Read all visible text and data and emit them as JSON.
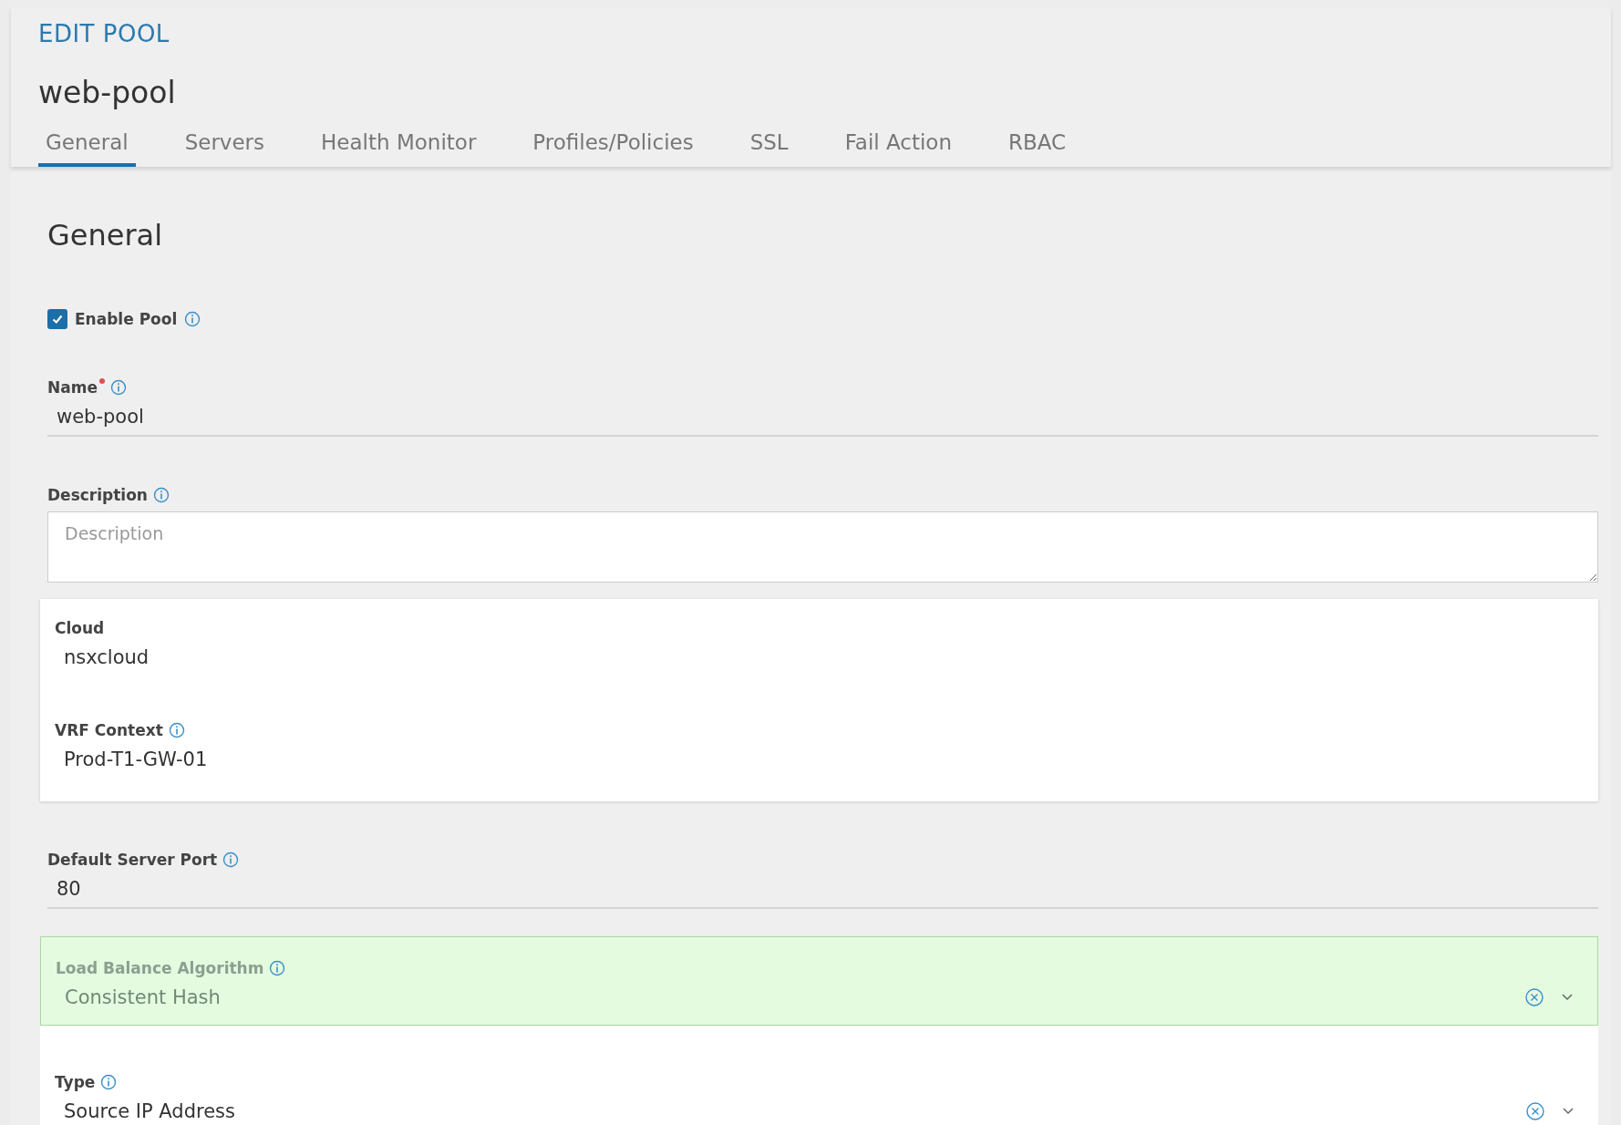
{
  "header": {
    "title": "EDIT POOL",
    "name": "web-pool"
  },
  "tabs": [
    {
      "label": "General",
      "selected": true
    },
    {
      "label": "Servers",
      "selected": false
    },
    {
      "label": "Health Monitor",
      "selected": false
    },
    {
      "label": "Profiles/Policies",
      "selected": false
    },
    {
      "label": "SSL",
      "selected": false
    },
    {
      "label": "Fail Action",
      "selected": false
    },
    {
      "label": "RBAC",
      "selected": false
    }
  ],
  "section_title": "General",
  "enable_pool": {
    "label": "Enable Pool",
    "checked": true,
    "info": true
  },
  "items": [
    {
      "kind": "text",
      "label": "Name",
      "required": true,
      "info": true,
      "value": "web-pool"
    },
    {
      "kind": "textarea",
      "label": "Description",
      "required": false,
      "info": true,
      "placeholder": "Description"
    },
    {
      "kind": "card",
      "fields": [
        {
          "label": "Cloud",
          "info": false,
          "value": "nsxcloud"
        },
        {
          "label": "VRF Context",
          "info": true,
          "value": "Prod-T1-GW-01"
        }
      ]
    },
    {
      "kind": "text",
      "label": "Default Server Port",
      "required": false,
      "info": true,
      "value": "80"
    },
    {
      "kind": "select",
      "label": "Load Balance Algorithm",
      "info": true,
      "highlighted": true,
      "value": "Consistent Hash"
    },
    {
      "kind": "select",
      "label": "Type",
      "info": true,
      "highlighted": false,
      "value": "Source IP Address"
    }
  ]
}
